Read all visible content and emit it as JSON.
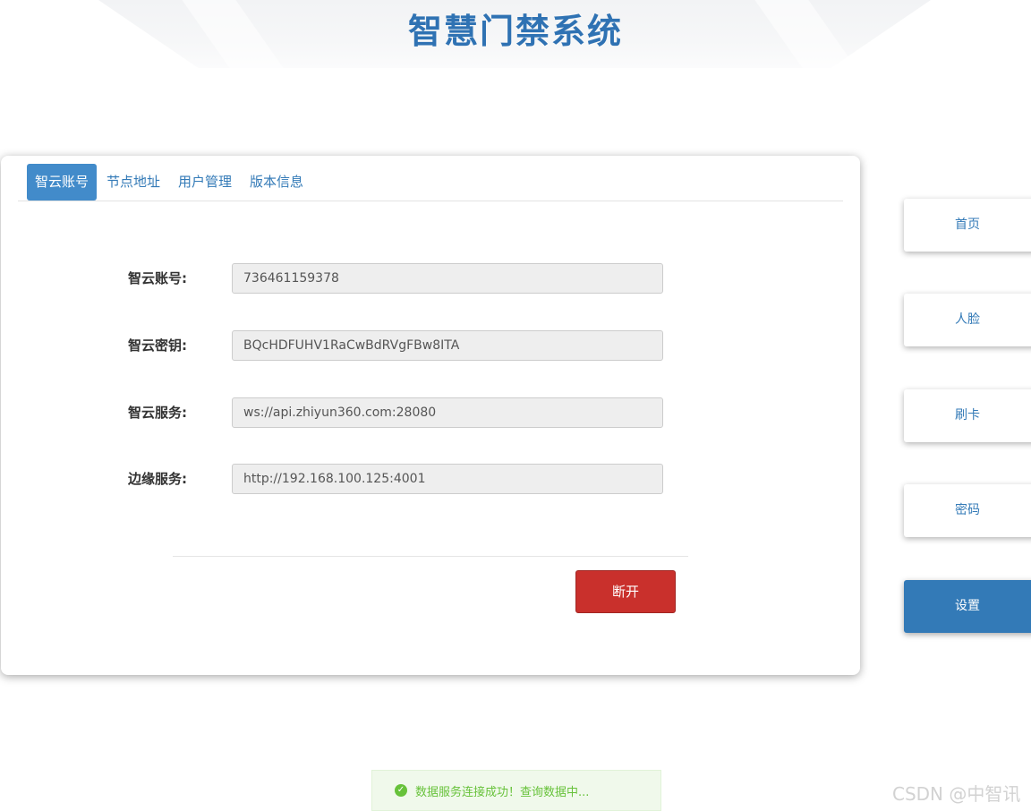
{
  "header": {
    "title": "智慧门禁系统"
  },
  "tabs": [
    {
      "label": "智云账号",
      "active": true
    },
    {
      "label": "节点地址",
      "active": false
    },
    {
      "label": "用户管理",
      "active": false
    },
    {
      "label": "版本信息",
      "active": false
    }
  ],
  "form": {
    "fields": [
      {
        "label": "智云账号:",
        "value": "736461159378"
      },
      {
        "label": "智云密钥:",
        "value": "BQcHDFUHV1RaCwBdRVgFBw8ITA"
      },
      {
        "label": "智云服务:",
        "value": "ws://api.zhiyun360.com:28080"
      },
      {
        "label": "边缘服务:",
        "value": "http://192.168.100.125:4001"
      }
    ],
    "disconnect_label": "断开"
  },
  "nav": [
    {
      "label": "首页",
      "active": false
    },
    {
      "label": "人脸",
      "active": false
    },
    {
      "label": "刷卡",
      "active": false
    },
    {
      "label": "密码",
      "active": false
    },
    {
      "label": "设置",
      "active": true
    }
  ],
  "toast": {
    "icon": "check-circle-icon",
    "message": "数据服务连接成功！查询数据中..."
  },
  "watermark": "CSDN @中智讯",
  "colors": {
    "title": "#2f72b3",
    "tab_active": "#428bca",
    "danger": "#c9302c",
    "nav_active": "#337ab7",
    "success": "#67c23a"
  }
}
